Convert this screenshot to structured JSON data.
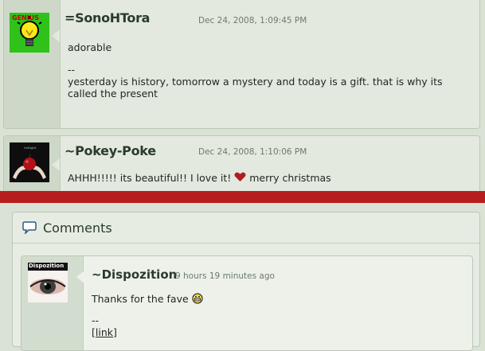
{
  "comments": [
    {
      "username": "=SonoHTora",
      "timestamp": "Dec 24, 2008, 1:09:45 PM",
      "message": "adorable",
      "sig_sep": "--",
      "signature": "yesterday is history, tomorrow a mystery and today is a gift. that is why its called the present",
      "avatar": "lightbulb-genius-avatar"
    },
    {
      "username": "~Pokey-Poke",
      "timestamp": "Dec 24, 2008, 1:10:06 PM",
      "message_start": "AHHH!!!!! its beautiful!! I love it!",
      "message_end": "merry christmas",
      "avatar": "apple-hands-avatar"
    }
  ],
  "panel": {
    "title": "Comments",
    "icon": "speech-bubble-icon"
  },
  "inner_comment": {
    "username": "~Dispozition",
    "timestamp": "9 hours 19 minutes ago",
    "message": "Thanks for the fave",
    "sig_sep": "--",
    "link_text": "[link]",
    "avatar_label": "Dispozition"
  },
  "colors": {
    "divider": "#b61d1d",
    "heart": "#b01e22"
  }
}
